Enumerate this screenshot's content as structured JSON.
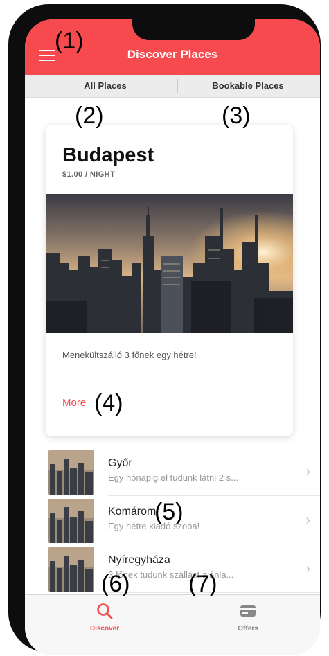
{
  "header": {
    "title": "Discover Places",
    "menu_icon": "hamburger-menu-icon"
  },
  "segments": [
    {
      "label": "All Places"
    },
    {
      "label": "Bookable Places"
    }
  ],
  "featured": {
    "title": "Budapest",
    "price": "$1.00 / NIGHT",
    "description": "Menekültszálló 3 főnek egy hétre!",
    "more_label": "More",
    "image": "city-skyline-image"
  },
  "places": [
    {
      "title": "Győr",
      "subtitle": "Egy hónapig el tudunk látni 2 s..."
    },
    {
      "title": "Komárom",
      "subtitle": "Egy hétre kiadó szoba!"
    },
    {
      "title": "Nyíregyháza",
      "subtitle": "3 főnek tudunk szállást ajánla..."
    }
  ],
  "tabs": [
    {
      "label": "Discover",
      "icon": "search-icon",
      "active": true
    },
    {
      "label": "Offers",
      "icon": "card-icon",
      "active": false
    }
  ],
  "annotations": [
    "(1)",
    "(2)",
    "(3)",
    "(4)",
    "(5)",
    "(6)",
    "(7)"
  ],
  "colors": {
    "accent": "#f64a4f",
    "segment_bg": "#ececec",
    "inactive": "#888888"
  }
}
